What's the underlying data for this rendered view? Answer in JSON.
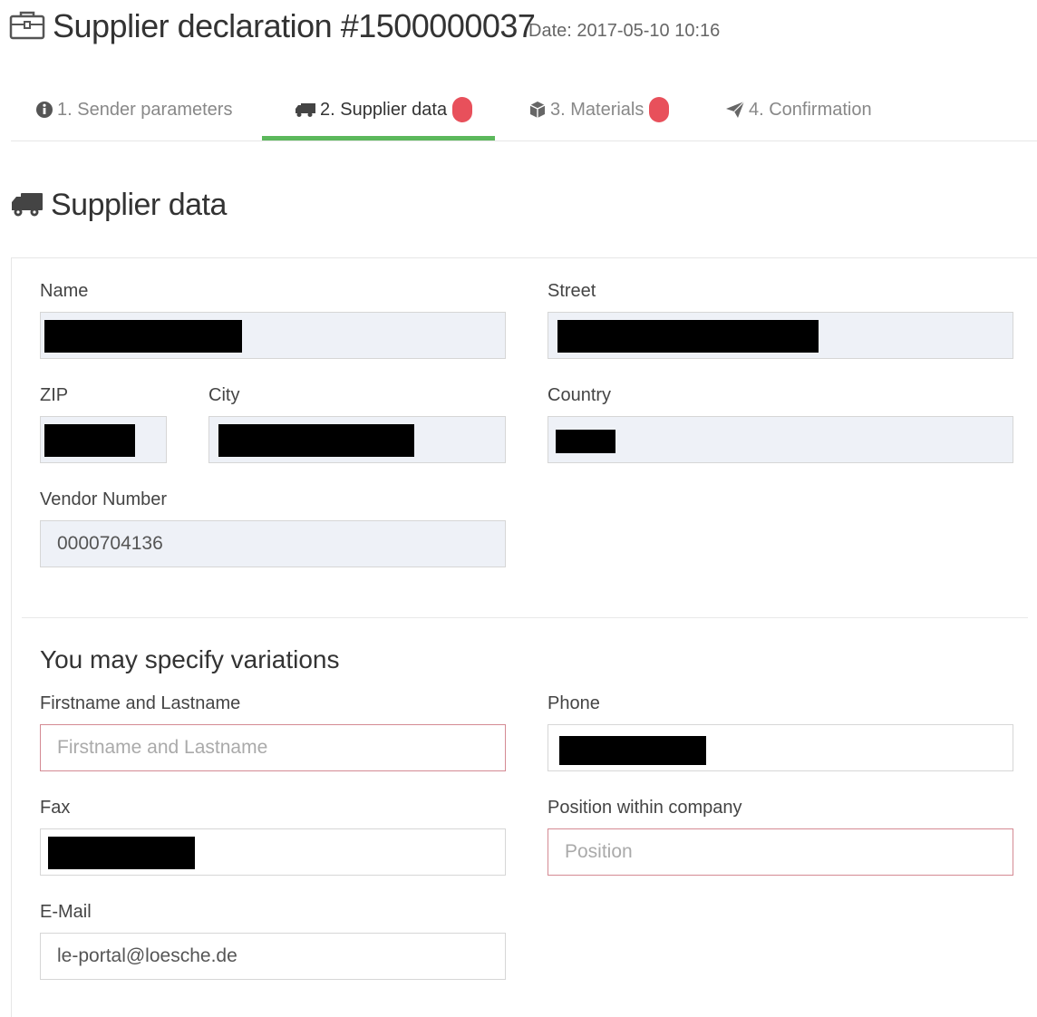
{
  "header": {
    "title": "Supplier declaration #1500000037",
    "date": "Date: 2017-05-10 10:16"
  },
  "tabs": [
    {
      "label": "1. Sender parameters",
      "icon": "info-circle-icon",
      "active": false,
      "badge": false
    },
    {
      "label": "2. Supplier data",
      "icon": "truck-icon",
      "active": true,
      "badge": true
    },
    {
      "label": "3. Materials",
      "icon": "cube-icon",
      "active": false,
      "badge": true
    },
    {
      "label": "4. Confirmation",
      "icon": "paper-plane-icon",
      "active": false,
      "badge": false
    }
  ],
  "section": {
    "title": "Supplier data",
    "icon": "truck-icon"
  },
  "form": {
    "name_label": "Name",
    "street_label": "Street",
    "zip_label": "ZIP",
    "city_label": "City",
    "country_label": "Country",
    "vendor_label": "Vendor Number",
    "vendor_value": "0000704136",
    "variations_heading": "You may specify variations",
    "fullname_label": "Firstname and Lastname",
    "fullname_placeholder": "Firstname and Lastname",
    "phone_label": "Phone",
    "fax_label": "Fax",
    "position_label": "Position within company",
    "position_placeholder": "Position",
    "email_label": "E-Mail",
    "email_value": "le-portal@loesche.de"
  },
  "colors": {
    "accent": "#5cb85c",
    "badge": "#e8505b",
    "readonly_field": "#eef1f7",
    "invalid_border": "#d48a93"
  }
}
